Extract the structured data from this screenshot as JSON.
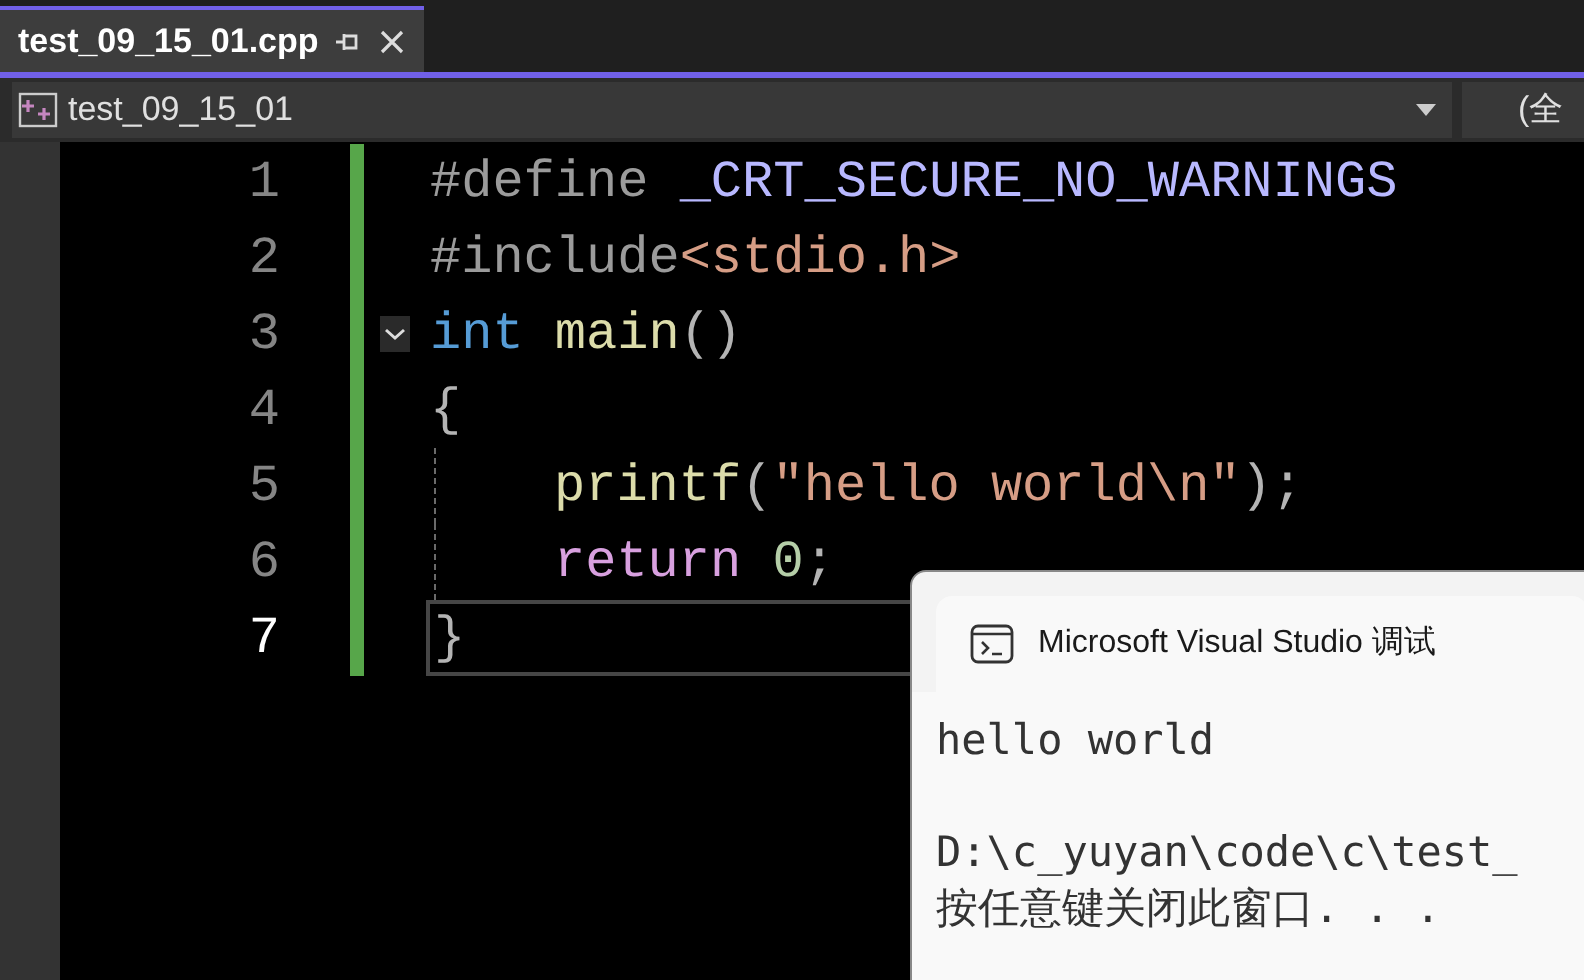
{
  "tabs": [
    {
      "label": "test_09_15_01.cpp",
      "selected": true
    }
  ],
  "navigation": {
    "project": "test_09_15_01",
    "scope": "(全"
  },
  "editor": {
    "lines": [
      {
        "number": "1",
        "current": false,
        "indented": false,
        "tokens": [
          {
            "kind": "preprocessor",
            "text": "#define "
          },
          {
            "kind": "macro",
            "text": "_CRT_SECURE_NO_WARNINGS"
          }
        ]
      },
      {
        "number": "2",
        "current": false,
        "indented": false,
        "tokens": [
          {
            "kind": "preprocessor",
            "text": "#include"
          },
          {
            "kind": "string",
            "text": "<stdio.h>"
          }
        ]
      },
      {
        "number": "3",
        "current": false,
        "indented": false,
        "fold": {
          "expanded": true
        },
        "tokens": [
          {
            "kind": "keyword",
            "text": "int"
          },
          {
            "kind": "function",
            "text": " main"
          },
          {
            "kind": "punct",
            "text": "()"
          }
        ]
      },
      {
        "number": "4",
        "current": false,
        "indented": false,
        "tokens": [
          {
            "kind": "punct",
            "text": "{"
          }
        ]
      },
      {
        "number": "5",
        "current": false,
        "indented": true,
        "tokens": [
          {
            "kind": "function",
            "text": "printf"
          },
          {
            "kind": "punct",
            "text": "("
          },
          {
            "kind": "string",
            "text": "\"hello world\\n\""
          },
          {
            "kind": "punct",
            "text": ");"
          }
        ]
      },
      {
        "number": "6",
        "current": false,
        "indented": true,
        "tokens": [
          {
            "kind": "control",
            "text": "return"
          },
          {
            "kind": "number",
            "text": " 0"
          },
          {
            "kind": "punct",
            "text": ";"
          }
        ]
      },
      {
        "number": "7",
        "current": true,
        "indented": false,
        "tokens": [
          {
            "kind": "punct",
            "text": "}"
          }
        ]
      }
    ]
  },
  "console": {
    "title": "Microsoft Visual Studio 调试",
    "blocks": [
      [
        "hello world"
      ],
      [
        "D:\\c_yuyan\\code\\c\\test_",
        "按任意键关闭此窗口. . ."
      ]
    ]
  }
}
